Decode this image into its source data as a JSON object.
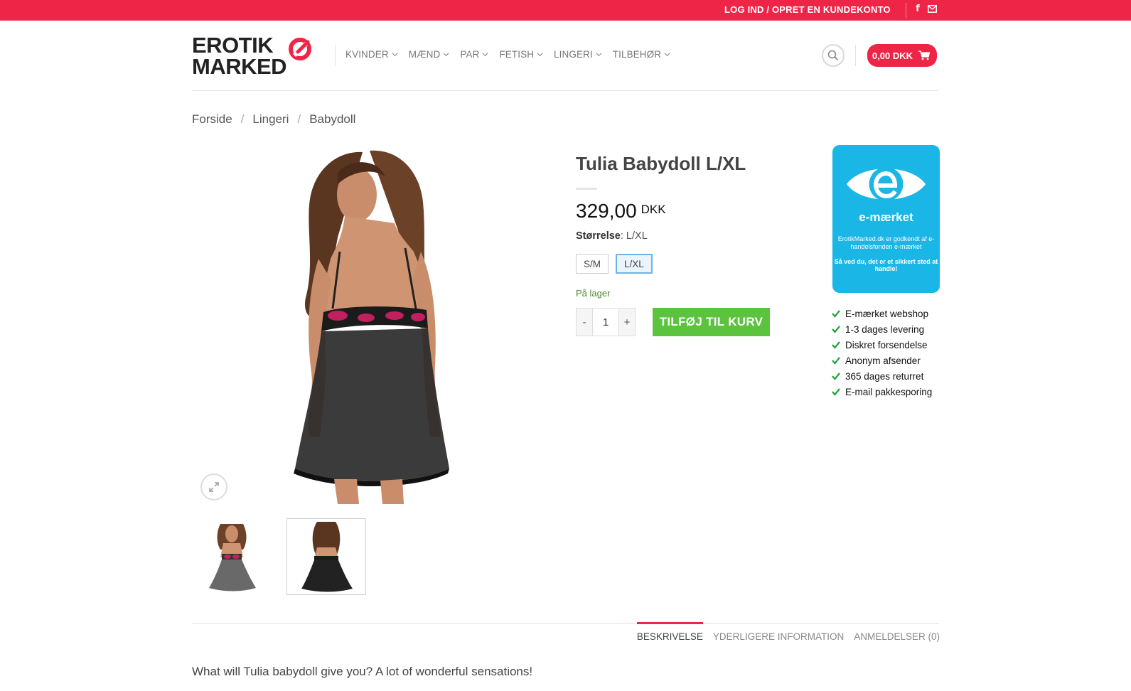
{
  "topbar": {
    "login_label": "LOG IND / OPRET EN KUNDEKONTO",
    "facebook_glyph": "f",
    "icons": [
      "facebook-icon",
      "mail-icon"
    ],
    "background": "#ee2547"
  },
  "header": {
    "logo_line1": "EROTIK",
    "logo_line2": "MARKED",
    "nav": [
      "KVINDER",
      "MÆND",
      "PAR",
      "FETISH",
      "LINGERI",
      "TILBEHØR"
    ],
    "cart_amount": "0,00 DKK"
  },
  "breadcrumb": {
    "home": "Forside",
    "category": "Lingeri",
    "current": "Babydoll",
    "separator": "/"
  },
  "product": {
    "title": "Tulia Babydoll L/XL",
    "price": "329,00",
    "currency": "DKK",
    "size_label": "Størrelse",
    "size_value": ": L/XL",
    "sizes": [
      "S/M",
      "L/XL"
    ],
    "selected_size": "L/XL",
    "stock": "På lager",
    "qty_minus": "-",
    "qty_value": "1",
    "qty_plus": "+",
    "add_to_cart": "TILFØJ TIL KURV"
  },
  "emark": {
    "brand": "e-mærket",
    "desc": "ErotikMarked.dk er godkendt af e-handelsfonden e-mærket",
    "note": "Så ved du, det er et sikkert sted at handle!"
  },
  "usps": [
    "E-mærket webshop",
    "1-3 dages levering",
    "Diskret forsendelse",
    "Anonym afsender",
    "365 dages returret",
    "E-mail pakkesporing"
  ],
  "tabs": [
    "BESKRIVELSE",
    "YDERLIGERE INFORMATION",
    "ANMELDELSER (0)"
  ],
  "active_tab": "BESKRIVELSE",
  "description": "What will Tulia babydoll give you? A lot of wonderful sensations!",
  "colors": {
    "accent": "#ee2547",
    "add_to_cart": "#5cc33f",
    "emark": "#1ab7e6",
    "stock": "#4c8a2e"
  }
}
